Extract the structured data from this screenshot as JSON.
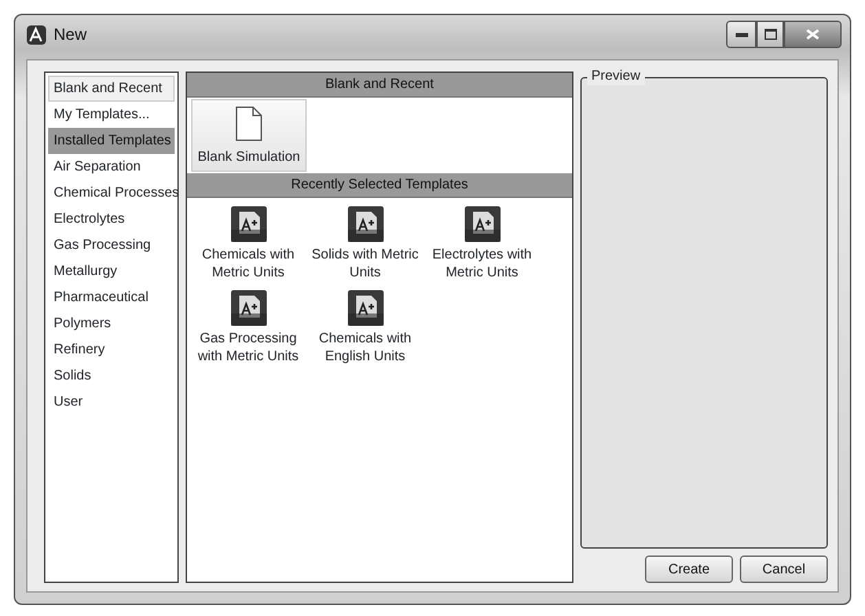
{
  "window": {
    "title": "New"
  },
  "sidebar": {
    "items": [
      {
        "label": "Blank and Recent",
        "kind": "link",
        "selected": true
      },
      {
        "label": "My Templates...",
        "kind": "link",
        "selected": false
      },
      {
        "label": "Installed Templates",
        "kind": "heading",
        "selected": false
      },
      {
        "label": "Air Separation",
        "kind": "link",
        "selected": false
      },
      {
        "label": "Chemical Processes",
        "kind": "link",
        "selected": false
      },
      {
        "label": "Electrolytes",
        "kind": "link",
        "selected": false
      },
      {
        "label": "Gas Processing",
        "kind": "link",
        "selected": false
      },
      {
        "label": "Metallurgy",
        "kind": "link",
        "selected": false
      },
      {
        "label": "Pharmaceutical",
        "kind": "link",
        "selected": false
      },
      {
        "label": "Polymers",
        "kind": "link",
        "selected": false
      },
      {
        "label": "Refinery",
        "kind": "link",
        "selected": false
      },
      {
        "label": "Solids",
        "kind": "link",
        "selected": false
      },
      {
        "label": "User",
        "kind": "link",
        "selected": false
      }
    ]
  },
  "sections": [
    {
      "title": "Blank and Recent",
      "items": [
        {
          "label": "Blank Simulation",
          "kind": "blank"
        }
      ]
    },
    {
      "title": "Recently Selected Templates",
      "items": [
        {
          "label": "Chemicals with Metric Units",
          "kind": "template"
        },
        {
          "label": "Solids with Metric Units",
          "kind": "template"
        },
        {
          "label": "Electrolytes with Metric Units",
          "kind": "template"
        },
        {
          "label": "Gas Processing with Metric Units",
          "kind": "template"
        },
        {
          "label": "Chemicals with English Units",
          "kind": "template"
        }
      ]
    }
  ],
  "preview": {
    "title": "Preview"
  },
  "buttons": [
    "Create",
    "Cancel"
  ]
}
